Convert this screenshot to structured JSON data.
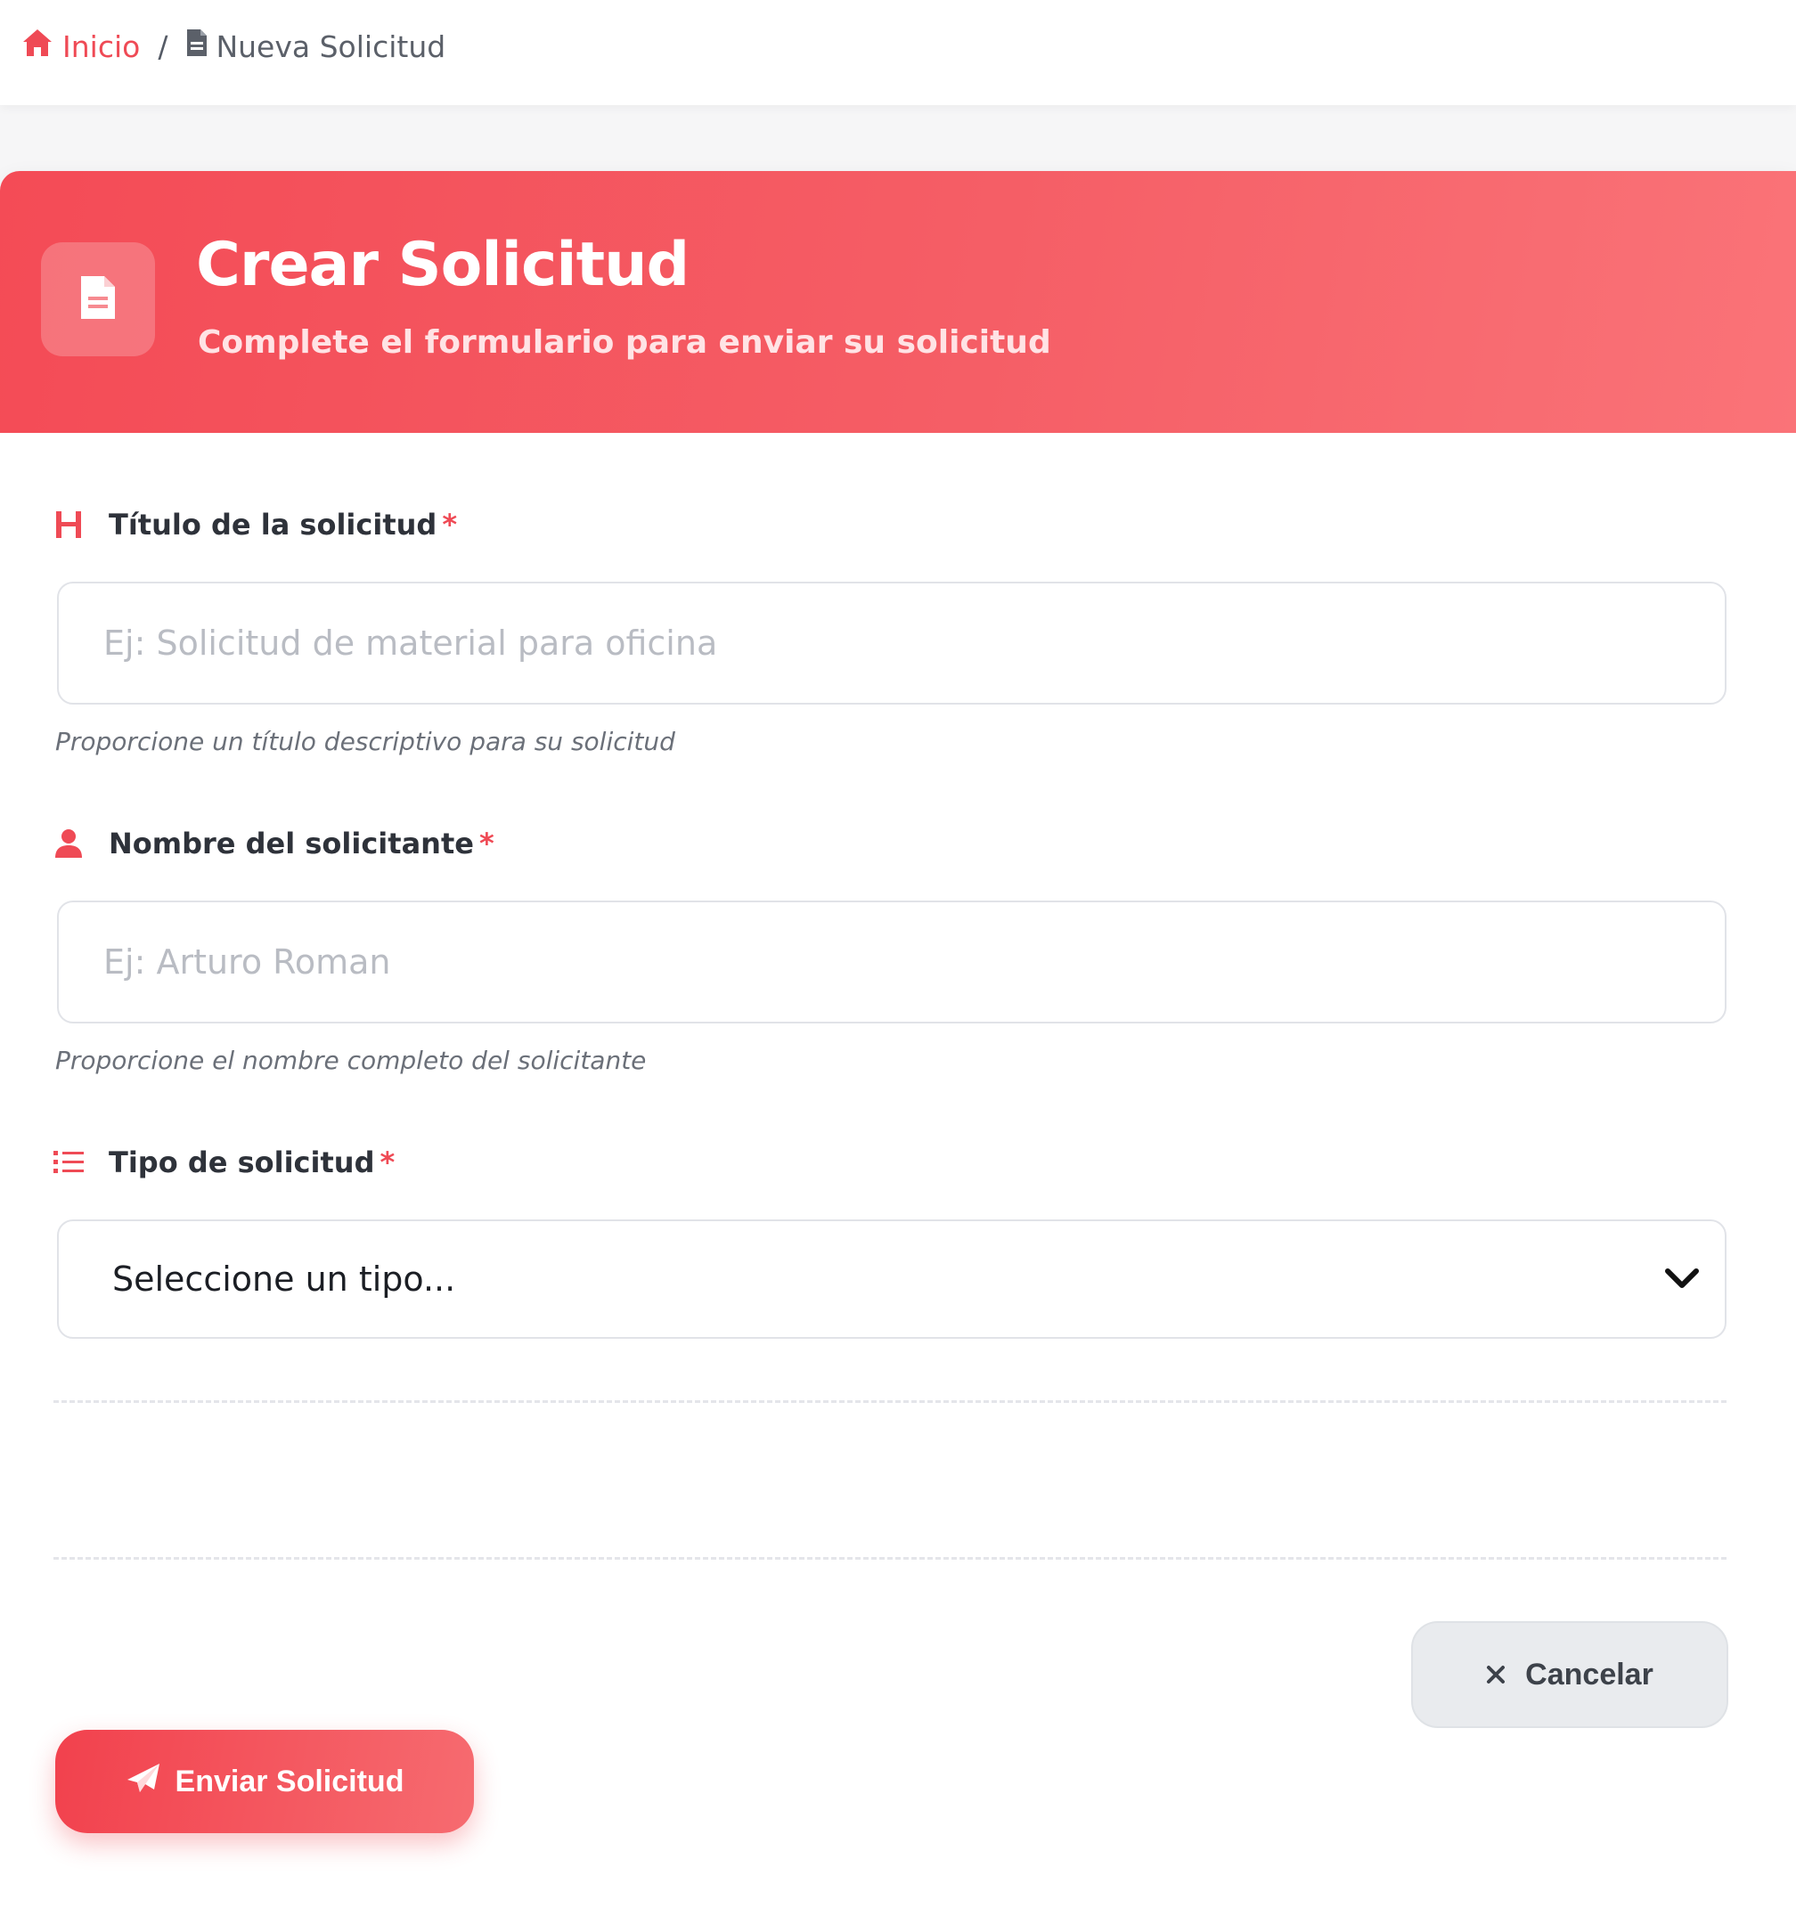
{
  "breadcrumb": {
    "home_label": "Inicio",
    "separator": "/",
    "current_label": "Nueva Solicitud"
  },
  "header": {
    "title": "Crear Solicitud",
    "subtitle": "Complete el formulario para enviar su solicitud"
  },
  "form": {
    "title_field": {
      "label": "Título de la solicitud",
      "required_mark": "*",
      "placeholder": "Ej: Solicitud de material para oficina",
      "value": "",
      "hint": "Proporcione un título descriptivo para su solicitud"
    },
    "name_field": {
      "label": "Nombre del solicitante",
      "required_mark": "*",
      "placeholder": "Ej: Arturo Roman",
      "value": "",
      "hint": "Proporcione el nombre completo del solicitante"
    },
    "type_field": {
      "label": "Tipo de solicitud",
      "required_mark": "*",
      "selected": "Seleccione un tipo..."
    }
  },
  "actions": {
    "cancel_label": "Cancelar",
    "submit_label": "Enviar Solicitud"
  },
  "icons": {
    "home": "home-icon",
    "file": "file-icon",
    "heading": "heading-icon",
    "user": "user-icon",
    "list": "list-icon",
    "chevron": "chevron-down-icon",
    "close": "close-icon",
    "send": "paper-plane-icon"
  },
  "colors": {
    "accent": "#ef4a55",
    "header_gradient_start": "#f44b56",
    "header_gradient_end": "#fa7378",
    "cancel_bg": "#e9ebee"
  }
}
